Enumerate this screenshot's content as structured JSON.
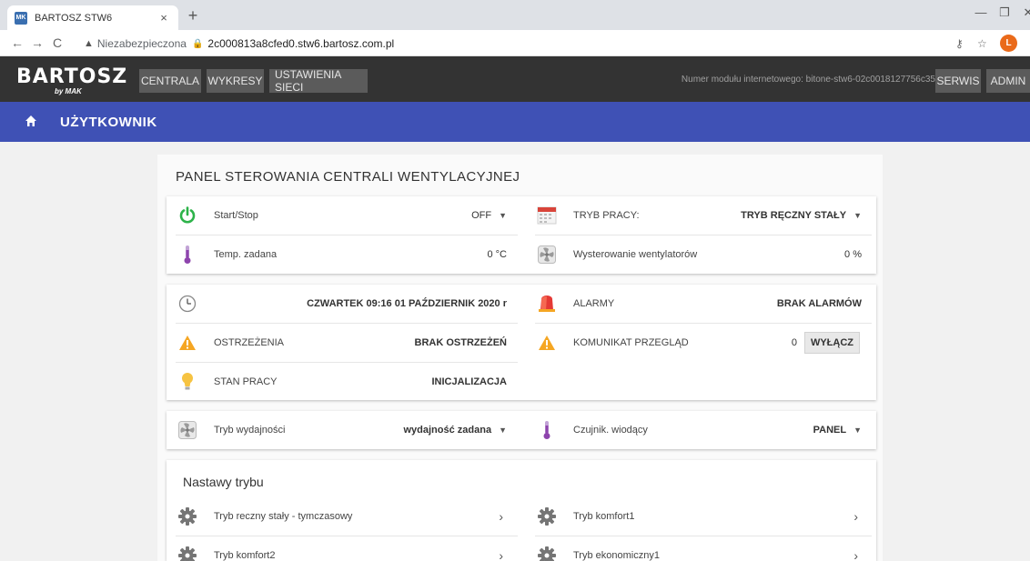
{
  "browser": {
    "tab_title": "BARTOSZ STW6",
    "tab_close": "×",
    "new_tab": "+",
    "back": "←",
    "forward": "→",
    "reload": "C",
    "insecure_label": "Niezabezpieczona",
    "url": "2c000813a8cfed0.stw6.bartosz.com.pl",
    "profile_initial": "L"
  },
  "header": {
    "logo": "BARTOSZ",
    "logo_sub": "by MAK",
    "nav": [
      "CENTRALA",
      "WYKRESY",
      "USTAWIENIA SIECI"
    ],
    "module_number": "Numer modułu internetowego: bitone-stw6-02c0018127756c35",
    "right_buttons": [
      "SERWIS",
      "ADMIN"
    ]
  },
  "subheader": {
    "title": "UŻYTKOWNIK"
  },
  "panel": {
    "title": "PANEL STEROWANIA CENTRALI WENTYLACYJNEJ",
    "card1": {
      "start_stop": {
        "label": "Start/Stop",
        "value": "OFF"
      },
      "tryb_pracy": {
        "label": "TRYB PRACY:",
        "value": "TRYB RĘCZNY STAŁY"
      },
      "temp_zadana": {
        "label": "Temp. zadana",
        "value": "0 °C"
      },
      "wysterowanie": {
        "label": "Wysterowanie wentylatorów",
        "value": "0 %"
      }
    },
    "card2": {
      "datetime": "CZWARTEK 09:16 01 PAŹDZIERNIK 2020 r",
      "alarmy": {
        "label": "ALARMY",
        "value": "BRAK ALARMÓW"
      },
      "ostrzezenia": {
        "label": "OSTRZEŻENIA",
        "value": "BRAK OSTRZEŻEŃ"
      },
      "komunikat": {
        "label": "KOMUNIKAT PRZEGLĄD",
        "value": "0",
        "button": "WYŁĄCZ"
      },
      "stan_pracy": {
        "label": "STAN PRACY",
        "value": "INICJALIZACJA"
      }
    },
    "card3": {
      "tryb_wydajnosci": {
        "label": "Tryb wydajności",
        "value": "wydajność zadana"
      },
      "czujnik": {
        "label": "Czujnik. wiodący",
        "value": "PANEL"
      }
    },
    "card4": {
      "title": "Nastawy trybu",
      "items": [
        "Tryb reczny stały - tymczasowy",
        "Tryb komfort1",
        "Tryb komfort2",
        "Tryb ekonomiczny1"
      ]
    }
  },
  "colors": {
    "accent": "#3f51b5",
    "header_bg": "#333333",
    "power_green": "#2db34a",
    "warning_orange": "#f5a623"
  }
}
